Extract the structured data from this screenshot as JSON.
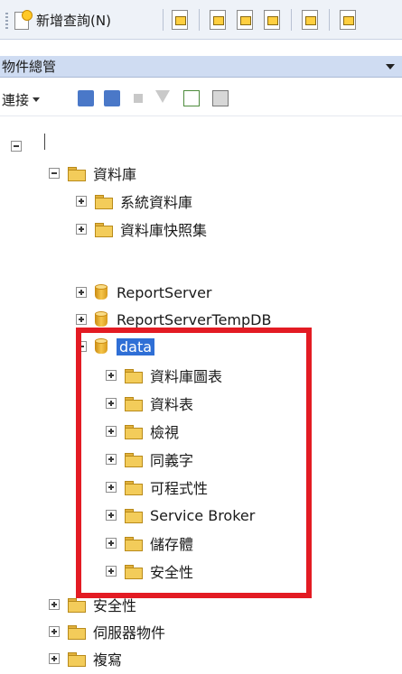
{
  "toolbar": {
    "new_query_label": "新增查詢(N)"
  },
  "panel": {
    "title": "物件總管"
  },
  "explorer_toolbar": {
    "connect_label": "連接"
  },
  "tree": {
    "databases": "資料庫",
    "system_dbs": "系統資料庫",
    "snapshots": "資料庫快照集",
    "db1": "ReportServer",
    "db2": "ReportServerTempDB",
    "db_selected": "data",
    "children": [
      "資料庫圖表",
      "資料表",
      "檢視",
      "同義字",
      "可程式性",
      "Service Broker",
      "儲存體",
      "安全性"
    ],
    "security": "安全性",
    "server_objects": "伺服器物件",
    "replication": "複寫"
  },
  "colors": {
    "highlight_border": "#e31b23",
    "selection": "#2f6fd6"
  }
}
